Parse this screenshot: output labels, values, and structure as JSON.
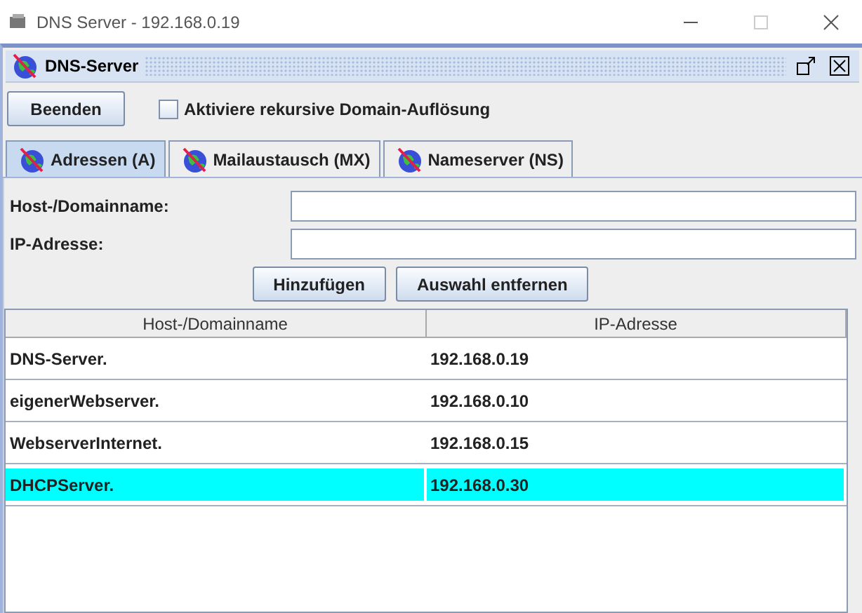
{
  "window": {
    "title": "DNS Server - 192.168.0.19"
  },
  "frame": {
    "title": "DNS-Server"
  },
  "toolbar": {
    "button": "Beenden",
    "checkbox": {
      "label": "Aktiviere rekursive Domain-Auflösung",
      "checked": false
    }
  },
  "tabs": [
    {
      "label": "Adressen (A)",
      "selected": true
    },
    {
      "label": "Mailaustausch (MX)",
      "selected": false
    },
    {
      "label": "Nameserver (NS)",
      "selected": false
    }
  ],
  "form": {
    "fields": [
      {
        "label": "Host-/Domainname:"
      },
      {
        "label": "IP-Adresse:"
      }
    ],
    "buttons": [
      "Hinzufügen",
      "Auswahl entfernen"
    ]
  },
  "table": {
    "columns": [
      "Host-/Domainname",
      "IP-Adresse"
    ],
    "rows": [
      {
        "cells": [
          "DNS-Server.",
          "192.168.0.19"
        ],
        "selected": false
      },
      {
        "cells": [
          "eigenerWebserver.",
          "192.168.0.10"
        ],
        "selected": false
      },
      {
        "cells": [
          "WebserverInternet.",
          "192.168.0.15"
        ],
        "selected": false
      },
      {
        "cells": [
          "DHCPServer.",
          "192.168.0.30"
        ],
        "selected": true
      }
    ]
  }
}
